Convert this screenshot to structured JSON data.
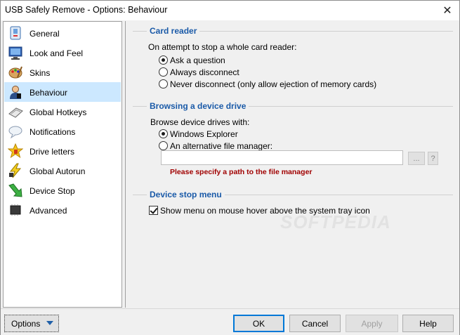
{
  "window": {
    "title": "USB Safely Remove - Options: Behaviour",
    "close_glyph": "✕"
  },
  "sidebar": {
    "selected_index": 3,
    "items": [
      {
        "label": "General",
        "icon": "general-icon"
      },
      {
        "label": "Look and Feel",
        "icon": "monitor-icon"
      },
      {
        "label": "Skins",
        "icon": "palette-icon"
      },
      {
        "label": "Behaviour",
        "icon": "user-icon"
      },
      {
        "label": "Global Hotkeys",
        "icon": "keyboard-icon"
      },
      {
        "label": "Notifications",
        "icon": "cloud-icon"
      },
      {
        "label": "Drive letters",
        "icon": "star-letter-icon"
      },
      {
        "label": "Global Autorun",
        "icon": "lightning-icon"
      },
      {
        "label": "Device Stop",
        "icon": "green-arrow-icon"
      },
      {
        "label": "Advanced",
        "icon": "chip-icon"
      }
    ]
  },
  "card_reader": {
    "title": "Card reader",
    "prompt": "On attempt to stop a whole card reader:",
    "options": [
      {
        "label": "Ask a question",
        "selected": true
      },
      {
        "label": "Always disconnect",
        "selected": false
      },
      {
        "label": "Never disconnect (only allow ejection of memory cards)",
        "selected": false
      }
    ]
  },
  "browsing": {
    "title": "Browsing a device drive",
    "prompt": "Browse device drives with:",
    "options": [
      {
        "label": "Windows Explorer",
        "selected": true
      },
      {
        "label": "An alternative file manager:",
        "selected": false
      }
    ],
    "path_value": "",
    "browse_label": "...",
    "help_label": "?",
    "error": "Please specify a path to the file manager"
  },
  "device_stop_menu": {
    "title": "Device stop menu",
    "checkbox_label": "Show menu on mouse hover above the system tray icon",
    "checked": true
  },
  "watermark": "SOFTPEDIA",
  "buttons": {
    "options": "Options",
    "ok": "OK",
    "cancel": "Cancel",
    "apply": "Apply",
    "help": "Help"
  }
}
